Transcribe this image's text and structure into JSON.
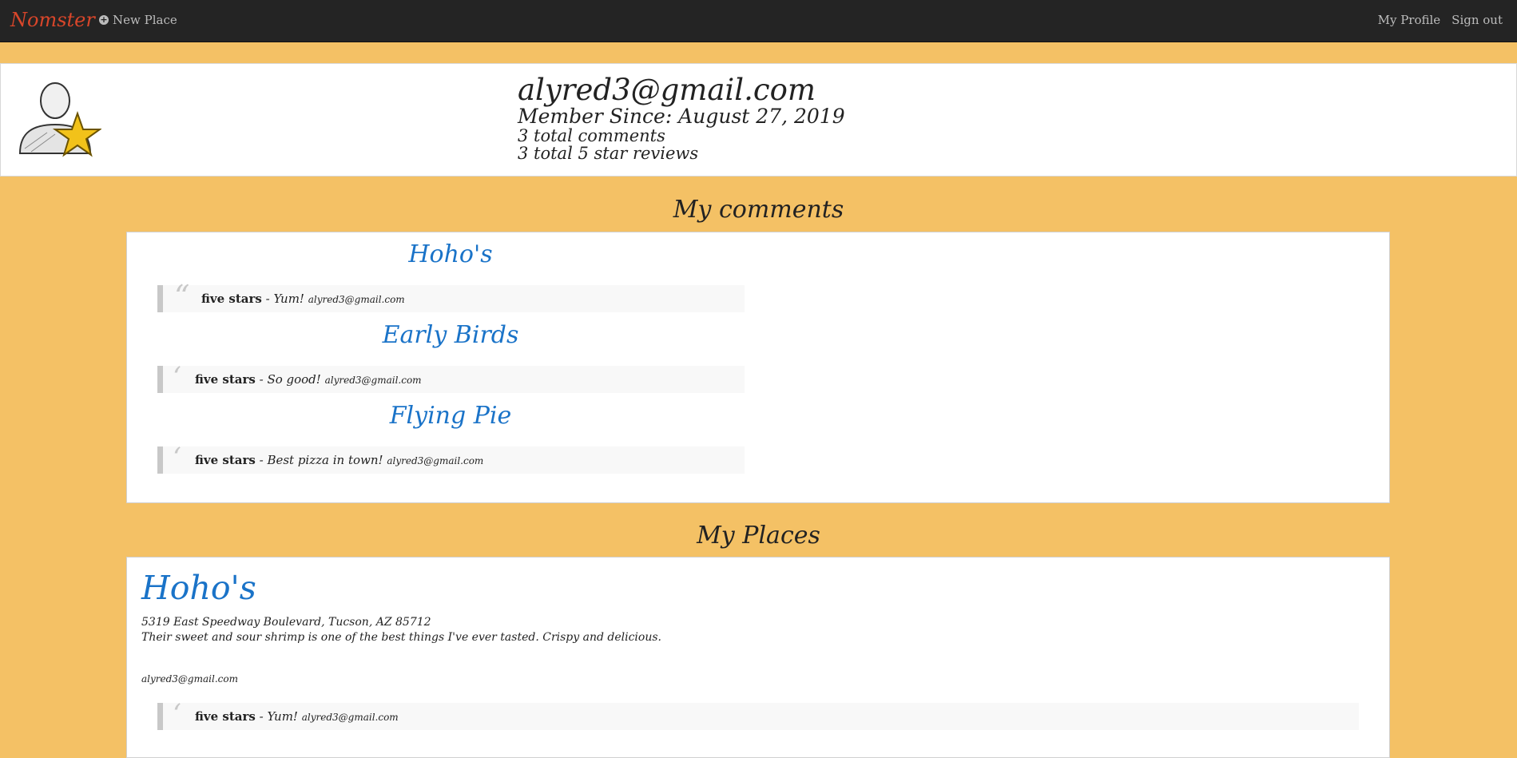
{
  "nav": {
    "brand": "Nomster",
    "new_place": "New Place",
    "my_profile": "My Profile",
    "sign_out": "Sign out"
  },
  "profile": {
    "email": "alyred3@gmail.com",
    "member_since": "Member Since: August 27, 2019",
    "total_comments": "3 total comments",
    "total_five_star": "3 total 5 star reviews"
  },
  "comments_section": {
    "title": "My comments",
    "items": [
      {
        "place": "Hoho's",
        "rating": "five stars",
        "separator": " - ",
        "text": "Yum!",
        "author": "alyred3@gmail.com"
      },
      {
        "place": "Early Birds",
        "rating": "five stars",
        "separator": " - ",
        "text": "So good!",
        "author": "alyred3@gmail.com"
      },
      {
        "place": "Flying Pie",
        "rating": "five stars",
        "separator": " - ",
        "text": "Best pizza in town!",
        "author": "alyred3@gmail.com"
      }
    ]
  },
  "places_section": {
    "title": "My Places",
    "place": {
      "name": "Hoho's",
      "address": "5319 East Speedway Boulevard, Tucson, AZ 85712",
      "description": "Their sweet and sour shrimp is one of the best things I've ever tasted. Crispy and delicious.",
      "owner": "alyred3@gmail.com",
      "comment": {
        "rating": "five stars",
        "separator": " - ",
        "text": "Yum!",
        "author": "alyred3@gmail.com"
      }
    }
  },
  "colors": {
    "background": "#f4c165",
    "navbar": "#242424",
    "brand": "#d9462a",
    "link": "#1a73c8"
  },
  "icons": {
    "new_place": "plus-circle-icon",
    "avatar": "user-star-avatar"
  }
}
